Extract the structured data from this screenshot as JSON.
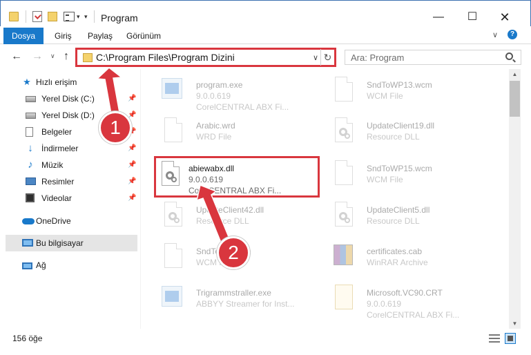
{
  "window": {
    "title": "Program",
    "controls": {
      "minimize": "—",
      "maximize": "☐",
      "close": "✕"
    }
  },
  "ribbon": {
    "tabs": [
      "Dosya",
      "Giriş",
      "Paylaş",
      "Görünüm"
    ],
    "help": "?"
  },
  "address": {
    "path": "C:\\Program Files\\Program Dizini",
    "refresh": "↻"
  },
  "search": {
    "placeholder": "Ara: Program"
  },
  "sidebar": {
    "quick_access": "Hızlı erişim",
    "items": [
      {
        "label": "Yerel Disk (C:)",
        "icon": "hard-disk-icon"
      },
      {
        "label": "Yerel Disk (D:)",
        "icon": "hard-disk-icon"
      },
      {
        "label": "Belgeler",
        "icon": "documents-icon"
      },
      {
        "label": "İndirmeler",
        "icon": "downloads-icon"
      },
      {
        "label": "Müzik",
        "icon": "music-icon"
      },
      {
        "label": "Resimler",
        "icon": "pictures-icon"
      },
      {
        "label": "Videolar",
        "icon": "videos-icon"
      }
    ],
    "onedrive": "OneDrive",
    "this_pc": "Bu bilgisayar",
    "network": "Ağ"
  },
  "files": {
    "left": [
      {
        "name": "program.exe",
        "line2": "9.0.0.619",
        "line3": "CorelCENTRAL ABX Fi...",
        "icon": "exe-icon"
      },
      {
        "name": "Arabic.wrd",
        "line2": "WRD File",
        "line3": "",
        "icon": "document-icon"
      },
      {
        "name": "abiewabx.dll",
        "line2": "9.0.0.619",
        "line3": "CorelCENTRAL ABX Fi...",
        "icon": "dll-icon"
      },
      {
        "name": "UpdateClient42.dll",
        "line2": "Resource DLL",
        "line3": "",
        "icon": "dll-icon"
      },
      {
        "name": "SndToWP.wcm",
        "line2": "WCM File",
        "line3": "",
        "icon": "document-icon"
      },
      {
        "name": "Trigrammstraller.exe",
        "line2": "ABBYY Streamer for Inst...",
        "line3": "",
        "icon": "exe-icon"
      }
    ],
    "right": [
      {
        "name": "SndToWP13.wcm",
        "line2": "WCM File",
        "line3": "",
        "icon": "document-icon"
      },
      {
        "name": "UpdateClient19.dll",
        "line2": "Resource DLL",
        "line3": "",
        "icon": "dll-icon"
      },
      {
        "name": "SndToWP15.wcm",
        "line2": "WCM File",
        "line3": "",
        "icon": "document-icon"
      },
      {
        "name": "UpdateClient5.dll",
        "line2": "Resource DLL",
        "line3": "",
        "icon": "dll-icon"
      },
      {
        "name": "certificates.cab",
        "line2": "WinRAR Archive",
        "line3": "",
        "icon": "archive-icon"
      },
      {
        "name": "Microsoft.VC90.CRT",
        "line2": "9.0.0.619",
        "line3": "CorelCENTRAL ABX Fi...",
        "icon": "certificate-icon"
      }
    ]
  },
  "status": {
    "count": "156 öğe"
  },
  "annotations": {
    "step1": "1",
    "step2": "2",
    "color": "#d9363e"
  }
}
